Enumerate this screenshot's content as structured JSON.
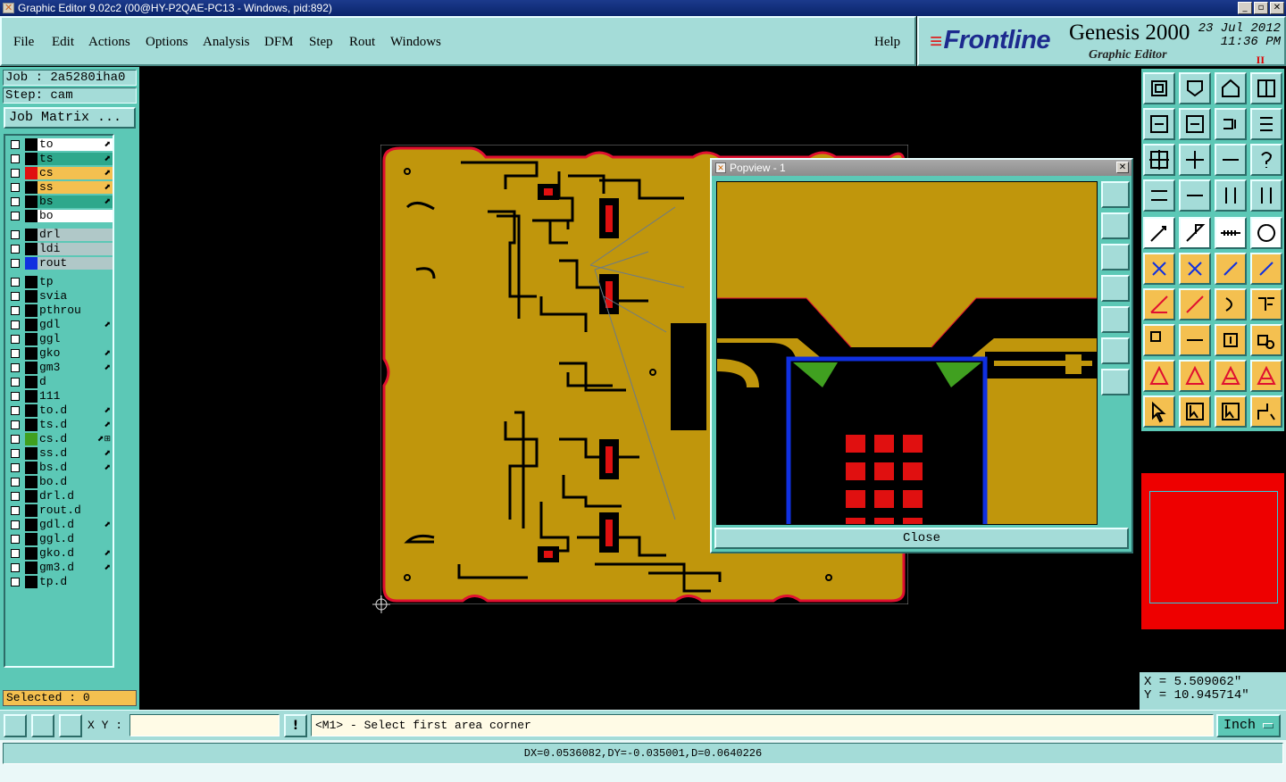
{
  "window": {
    "title": "Graphic Editor 9.02c2 (00@HY-P2QAE-PC13 - Windows, pid:892)",
    "controls": [
      "_",
      "▫",
      "✕"
    ]
  },
  "menu": {
    "items": [
      "File",
      "Edit",
      "Actions",
      "Options",
      "Analysis",
      "DFM",
      "Step",
      "Rout",
      "Windows"
    ],
    "help": "Help"
  },
  "brand": {
    "logo": "Frontline",
    "product": "Genesis 2000",
    "subtitle": "Graphic Editor",
    "date": "23 Jul 2012",
    "time": "11:36 PM",
    "pause": "II"
  },
  "job": {
    "job_label": "Job : 2a5280iha0",
    "step_label": "Step: cam",
    "matrix_button": "Job Matrix ..."
  },
  "layers": [
    {
      "name": "to",
      "color": "#000000",
      "bg": "#ffffff",
      "flag": "⬈"
    },
    {
      "name": "ts",
      "color": "#000000",
      "bg": "#2ea88c",
      "flag": "⬈"
    },
    {
      "name": "cs",
      "color": "#e01010",
      "bg": "#f4c050",
      "flag": "⬈"
    },
    {
      "name": "ss",
      "color": "#000000",
      "bg": "#f4c050",
      "flag": "⬈"
    },
    {
      "name": "bs",
      "color": "#000000",
      "bg": "#2ea88c",
      "flag": "⬈"
    },
    {
      "name": "bo",
      "color": "#000000",
      "bg": "#ffffff",
      "flag": ""
    },
    {
      "name": "drl",
      "color": "#000000",
      "bg": "#b0c8c8",
      "flag": ""
    },
    {
      "name": "ldi",
      "color": "#000000",
      "bg": "#b0c8c8",
      "flag": ""
    },
    {
      "name": "rout",
      "color": "#1030e0",
      "bg": "#b0c8c8",
      "flag": ""
    },
    {
      "name": "tp",
      "color": "#000000",
      "bg": "#5cc8b6",
      "flag": ""
    },
    {
      "name": "svia",
      "color": "#000000",
      "bg": "#5cc8b6",
      "flag": ""
    },
    {
      "name": "pthrou",
      "color": "#000000",
      "bg": "#5cc8b6",
      "flag": ""
    },
    {
      "name": "gdl",
      "color": "#000000",
      "bg": "#5cc8b6",
      "flag": "⬈"
    },
    {
      "name": "ggl",
      "color": "#000000",
      "bg": "#5cc8b6",
      "flag": ""
    },
    {
      "name": "gko",
      "color": "#000000",
      "bg": "#5cc8b6",
      "flag": "⬈"
    },
    {
      "name": "gm3",
      "color": "#000000",
      "bg": "#5cc8b6",
      "flag": "⬈"
    },
    {
      "name": "d",
      "color": "#000000",
      "bg": "#5cc8b6",
      "flag": ""
    },
    {
      "name": "111",
      "color": "#000000",
      "bg": "#5cc8b6",
      "flag": ""
    },
    {
      "name": "to.d",
      "color": "#000000",
      "bg": "#5cc8b6",
      "flag": "⬈"
    },
    {
      "name": "ts.d",
      "color": "#000000",
      "bg": "#5cc8b6",
      "flag": "⬈"
    },
    {
      "name": "cs.d",
      "color": "#40a020",
      "bg": "#5cc8b6",
      "flag": "⬈⊞"
    },
    {
      "name": "ss.d",
      "color": "#000000",
      "bg": "#5cc8b6",
      "flag": "⬈"
    },
    {
      "name": "bs.d",
      "color": "#000000",
      "bg": "#5cc8b6",
      "flag": "⬈"
    },
    {
      "name": "bo.d",
      "color": "#000000",
      "bg": "#5cc8b6",
      "flag": ""
    },
    {
      "name": "drl.d",
      "color": "#000000",
      "bg": "#5cc8b6",
      "flag": ""
    },
    {
      "name": "rout.d",
      "color": "#000000",
      "bg": "#5cc8b6",
      "flag": ""
    },
    {
      "name": "gdl.d",
      "color": "#000000",
      "bg": "#5cc8b6",
      "flag": "⬈"
    },
    {
      "name": "ggl.d",
      "color": "#000000",
      "bg": "#5cc8b6",
      "flag": ""
    },
    {
      "name": "gko.d",
      "color": "#000000",
      "bg": "#5cc8b6",
      "flag": "⬈"
    },
    {
      "name": "gm3.d",
      "color": "#000000",
      "bg": "#5cc8b6",
      "flag": "⬈"
    },
    {
      "name": "tp.d",
      "color": "#000000",
      "bg": "#5cc8b6",
      "flag": ""
    }
  ],
  "selected": "Selected : 0",
  "popview": {
    "title": "Popview - 1",
    "close_label": "Close",
    "close_x": "✕"
  },
  "coords": {
    "x": "X =  5.509062\"",
    "y": "Y = 10.945714\""
  },
  "bottom": {
    "xy_label": "X Y :",
    "xy_value": "",
    "warn": "!",
    "prompt": "<M1> - Select first area corner",
    "units": "Inch"
  },
  "status": "DX=0.0536082,DY=-0.035001,D=0.0640226",
  "colors": {
    "panel": "#5cc8b6",
    "panel_light": "#a4dcd8",
    "copper": "#c0960c",
    "board_outline": "#e01030",
    "highlight": "#f4c050"
  }
}
